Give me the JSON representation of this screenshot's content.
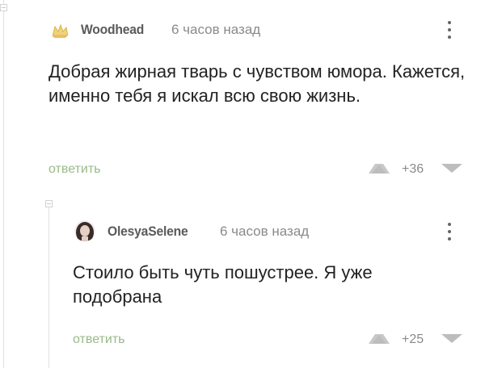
{
  "comments": [
    {
      "author": "Woodhead",
      "time": "6 часов назад",
      "text": "Добрая жирная тварь с чувством юмора. Кажется, именно тебя я искал всю свою жизнь.",
      "reply_label": "ответить",
      "rating": "+36"
    },
    {
      "author": "OlesyaSelene",
      "time": "6 часов назад",
      "text": "Стоило быть чуть пошустрее. Я уже подобрана",
      "reply_label": "ответить",
      "rating": "+25"
    }
  ],
  "colors": {
    "reply": "#9ab98a",
    "text": "#222222",
    "meta": "#8a8a8a"
  }
}
